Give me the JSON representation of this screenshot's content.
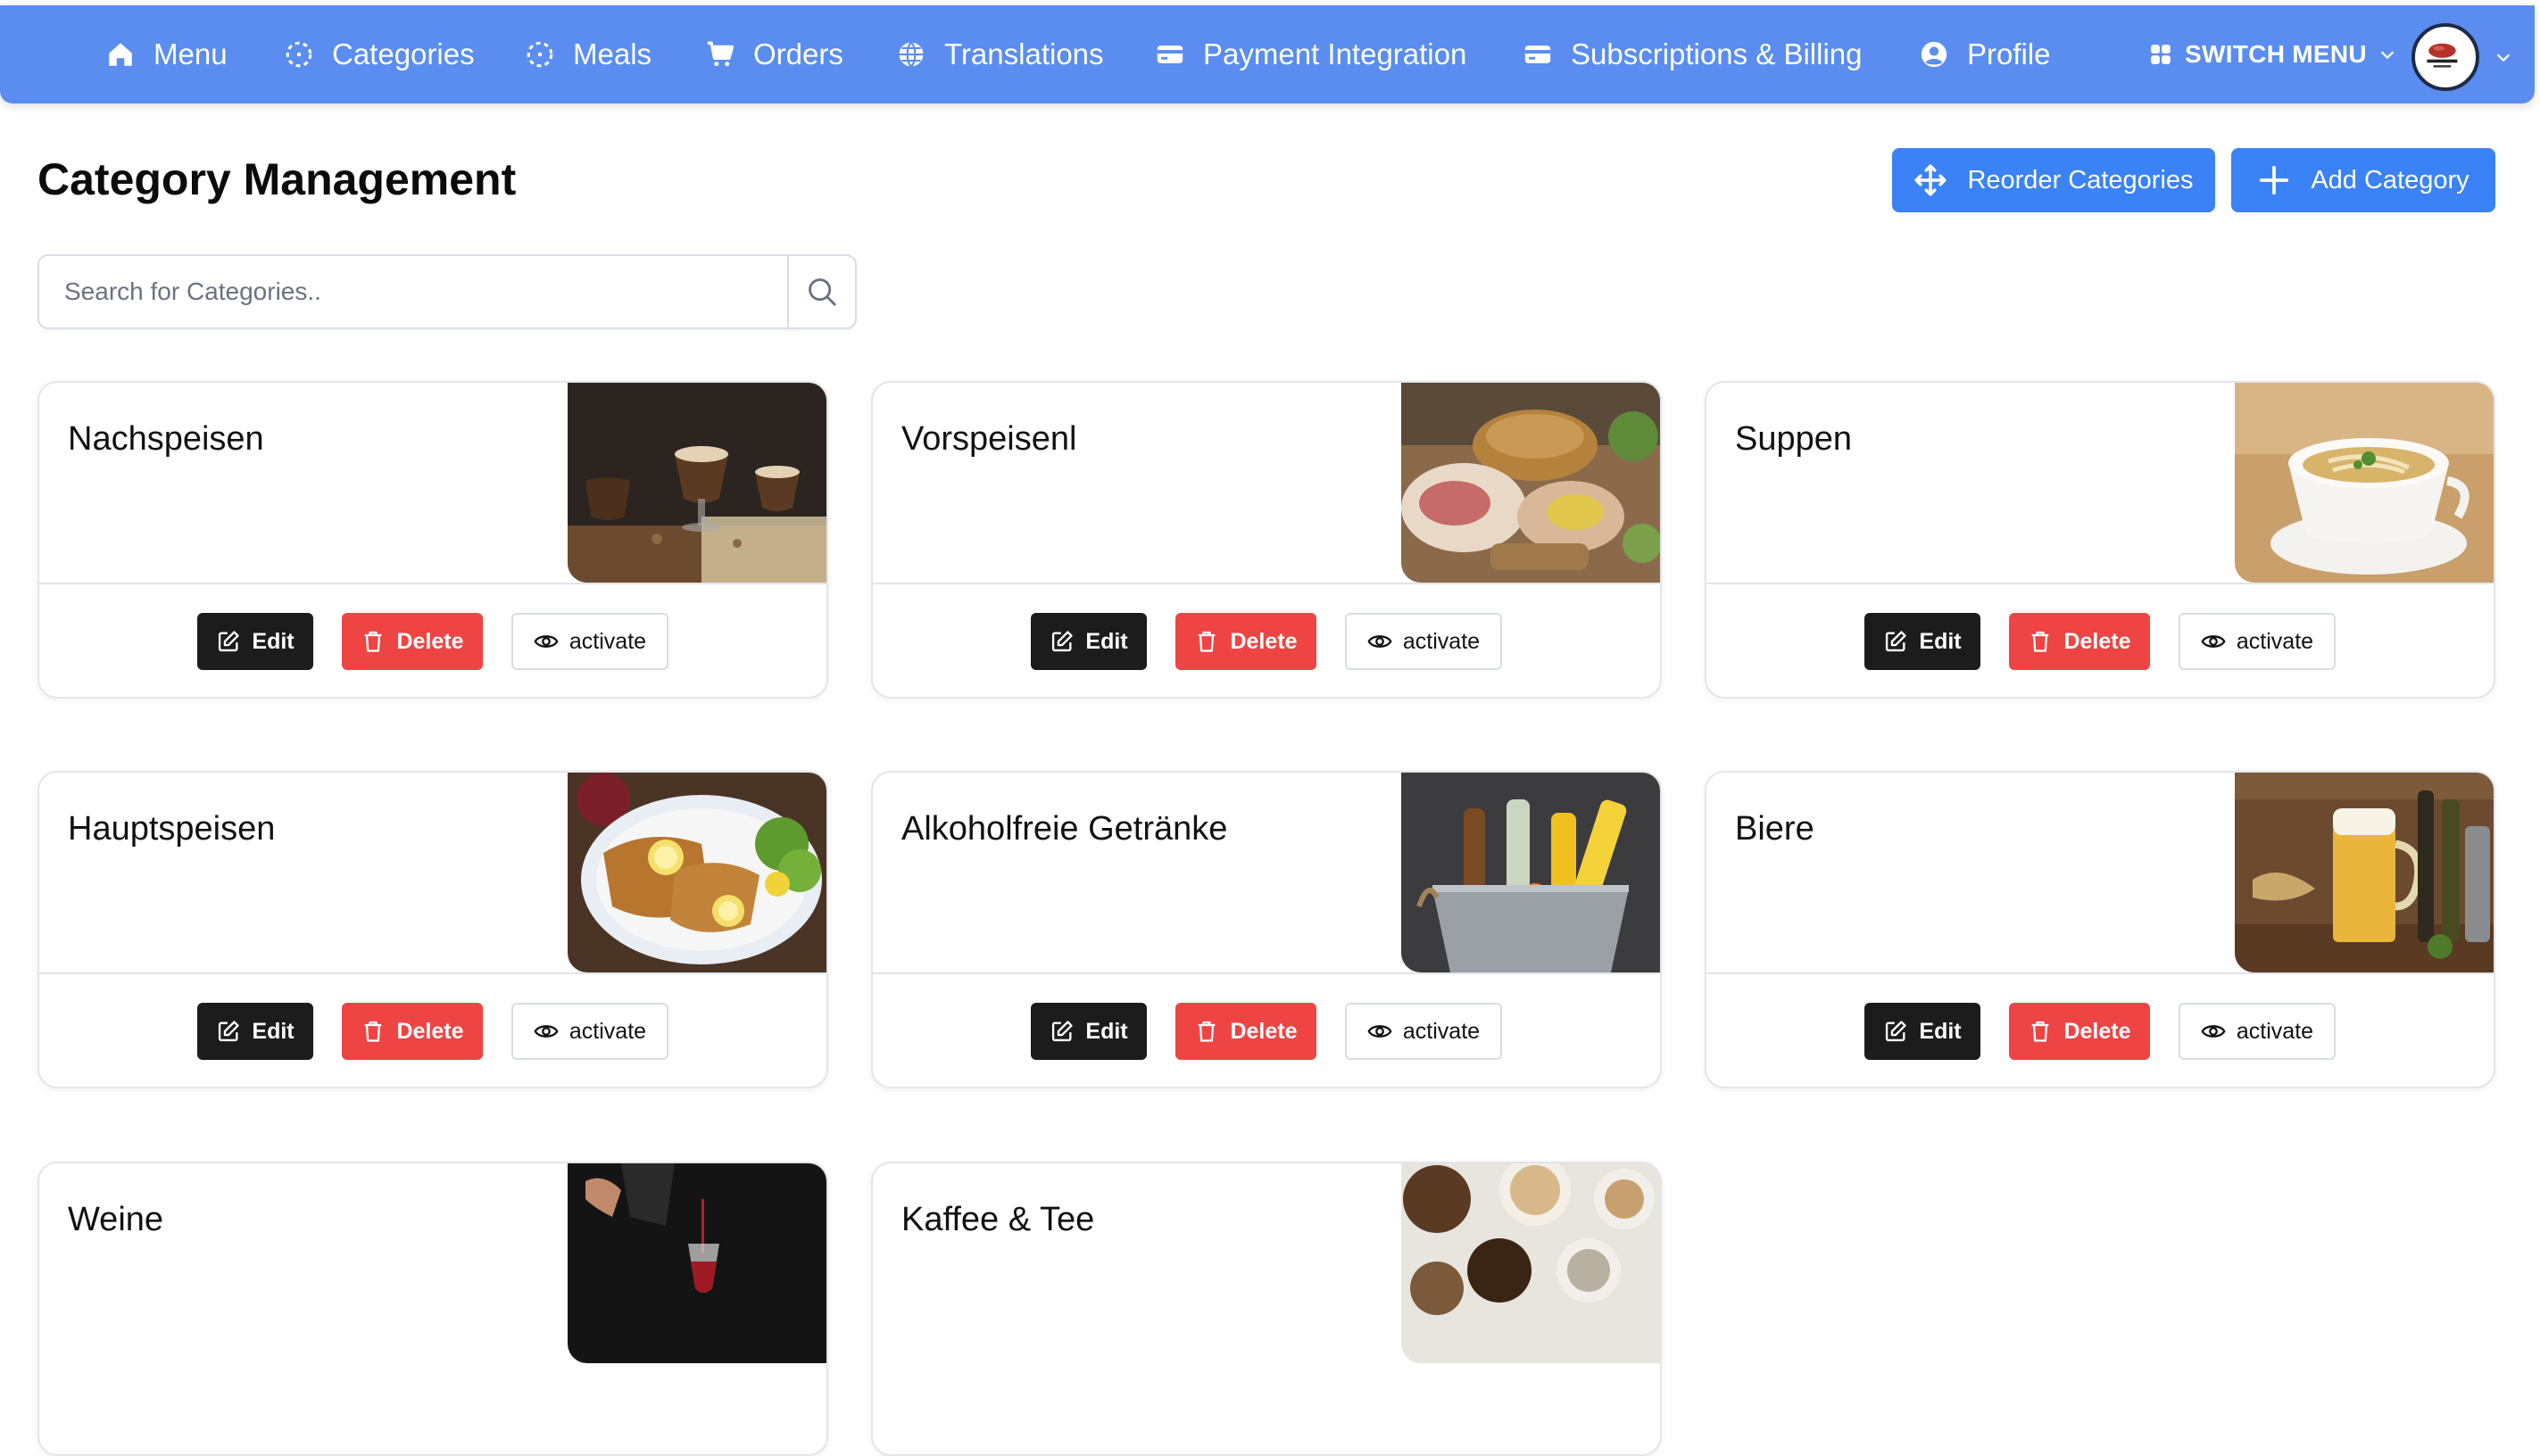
{
  "nav": {
    "items": [
      {
        "label": "Menu",
        "icon": "home-icon"
      },
      {
        "label": "Categories",
        "icon": "dashed-circle-icon"
      },
      {
        "label": "Meals",
        "icon": "dashed-circle-icon"
      },
      {
        "label": "Orders",
        "icon": "cart-icon"
      },
      {
        "label": "Translations",
        "icon": "globe-icon"
      },
      {
        "label": "Payment Integration",
        "icon": "credit-card-icon"
      },
      {
        "label": "Subscriptions & Billing",
        "icon": "credit-card-icon"
      },
      {
        "label": "Profile",
        "icon": "user-circle-icon"
      }
    ],
    "switch_menu": "SWITCH MENU",
    "accent": "#5a8def"
  },
  "header": {
    "title": "Category Management",
    "reorder_label": "Reorder Categories",
    "add_label": "Add Category"
  },
  "search": {
    "placeholder": "Search for Categories.."
  },
  "actions": {
    "edit": "Edit",
    "delete": "Delete",
    "activate": "activate"
  },
  "categories": [
    {
      "name": "Nachspeisen",
      "image": "chocolate-dessert-photo"
    },
    {
      "name": "Vorspeisenl",
      "image": "appetizer-platter-photo"
    },
    {
      "name": "Suppen",
      "image": "soup-bowl-photo"
    },
    {
      "name": "Hauptspeisen",
      "image": "schnitzel-plate-photo"
    },
    {
      "name": "Alkoholfreie Getränke",
      "image": "bottles-in-ice-bucket-photo"
    },
    {
      "name": "Biere",
      "image": "beer-mug-photo"
    },
    {
      "name": "Weine",
      "image": "wine-pouring-photo"
    },
    {
      "name": "Kaffee & Tee",
      "image": "coffee-cups-photo"
    }
  ],
  "colors": {
    "primary_button": "#3b82f6",
    "delete_button": "#ef4444",
    "edit_button": "#1c1c1c"
  }
}
